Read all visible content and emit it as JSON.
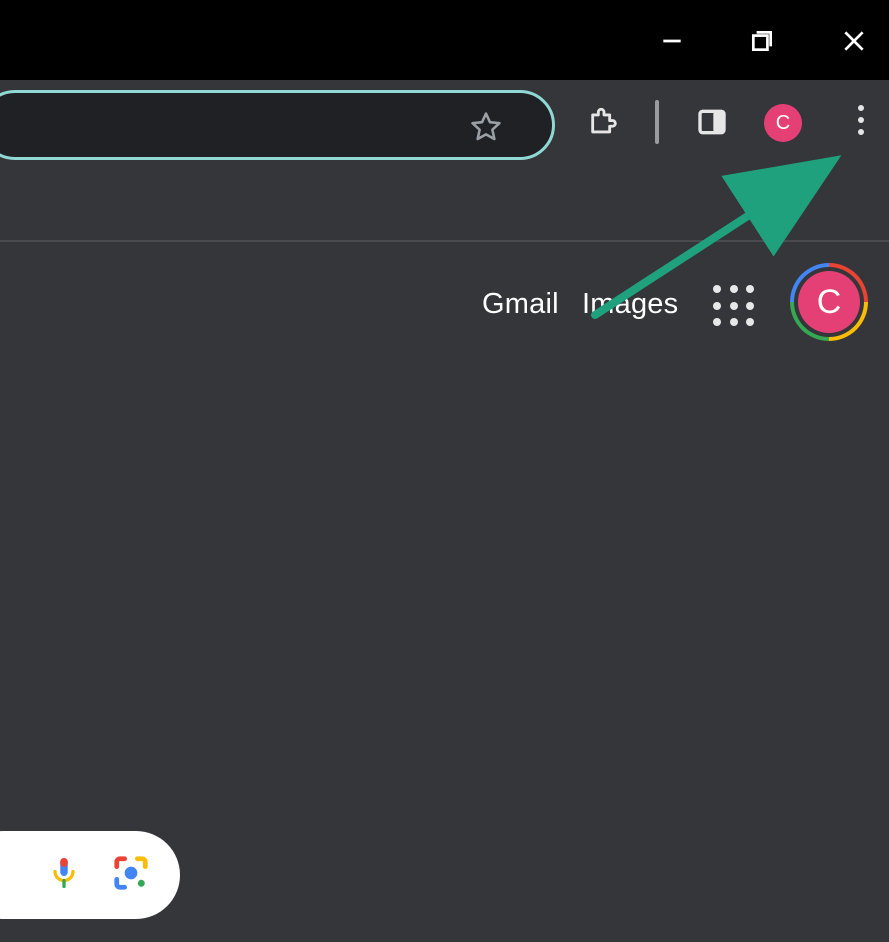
{
  "window": {
    "minimize_icon": "minimize",
    "maximize_icon": "maximize",
    "close_icon": "close"
  },
  "toolbar": {
    "bookmark_icon": "star-outline",
    "extensions_icon": "puzzle",
    "side_panel_icon": "side-panel",
    "profile_initial": "C",
    "menu_icon": "more-vert"
  },
  "page": {
    "links": {
      "gmail": "Gmail",
      "images": "Images"
    },
    "apps_icon": "google-apps",
    "account_initial": "C",
    "voice_search_icon": "microphone",
    "lens_icon": "google-lens"
  },
  "annotation": {
    "arrow_color": "#1fa17e"
  }
}
